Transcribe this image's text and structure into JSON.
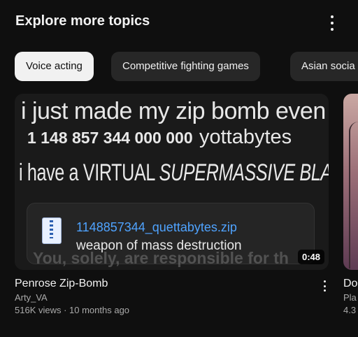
{
  "header": {
    "title": "Explore more topics"
  },
  "chips": [
    {
      "label": "Voice acting",
      "selected": true
    },
    {
      "label": "Competitive fighting games",
      "selected": false
    },
    {
      "label": "Asian socia",
      "selected": false
    }
  ],
  "video1": {
    "thumb": {
      "line1": "i just made my zip bomb even larger.",
      "line2_num": "1 148 857 344 000 000",
      "line2_unit": "yottabytes",
      "line3_a": "i have a VIRTUAL ",
      "line3_b": "SUPERMASSIVE BLACK HOLE.",
      "file_name": "1148857344_quettabytes.zip",
      "file_desc": "weapon of mass destruction",
      "watermark": "You, solely, are responsible for th"
    },
    "duration": "0:48",
    "title": "Penrose Zip-Bomb",
    "channel": "Arty_VA",
    "meta": "516K views · 10 months ago"
  },
  "video2": {
    "title": "Do",
    "channel": "Pla",
    "meta": "4.3"
  },
  "colors": {
    "background": "#0f0f0f",
    "chip_selected": "#f1f1f1",
    "chip": "#272727",
    "link": "#4fa3ff"
  }
}
